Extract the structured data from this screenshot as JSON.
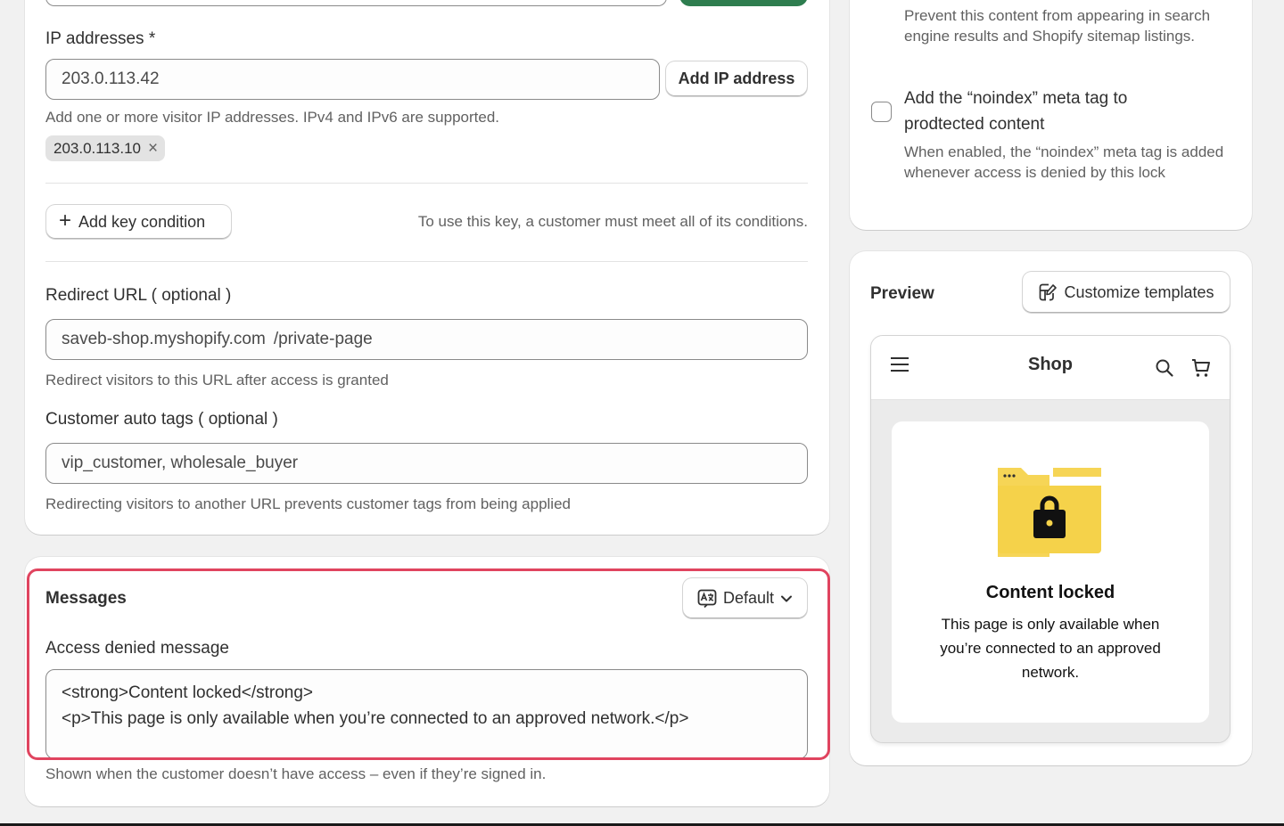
{
  "ip_section": {
    "label": "IP addresses *",
    "input_value": "203.0.113.42",
    "add_button": "Add IP address",
    "help": "Add one or more visitor IP addresses. IPv4 and IPv6 are supported.",
    "tags": [
      {
        "text": "203.0.113.10",
        "remove": "×"
      }
    ]
  },
  "key_condition": {
    "add_button": "Add key condition",
    "note": "To use this key, a customer must meet all of its conditions."
  },
  "redirect": {
    "label": "Redirect URL ( optional )",
    "domain": "saveb-shop.myshopify.com",
    "path": "/private-page",
    "help": "Redirect visitors to this URL after access is granted"
  },
  "auto_tags": {
    "label": "Customer auto tags ( optional )",
    "value": "vip_customer, wholesale_buyer",
    "help": "Redirecting visitors to another URL prevents customer tags from being applied"
  },
  "messages": {
    "title": "Messages",
    "language_button": "Default",
    "access_label": "Access denied message",
    "message_line1": "<strong>Content locked</strong>",
    "message_line2": "<p>This page is only available when you’re connected to an approved network.</p>",
    "help": "Shown when the customer doesn’t have access – even if they’re signed in.",
    "highlight_color": "#e0445f"
  },
  "seo": {
    "hide_help": "Prevent this content from appearing in search engine results and Shopify sitemap listings.",
    "noindex_label": "Add the “noindex” meta tag to prodtected content",
    "noindex_help": "When enabled, the “noindex” meta tag is added whenever access is denied by this lock",
    "noindex_checked": false
  },
  "preview": {
    "title": "Preview",
    "customize_button": "Customize templates",
    "shop_name": "Shop",
    "locked_title": "Content locked",
    "locked_text": "This page is only available when you’re connected to an approved network."
  },
  "colors": {
    "primary_button": "#2e7d4f",
    "folder": "#f6d556"
  }
}
